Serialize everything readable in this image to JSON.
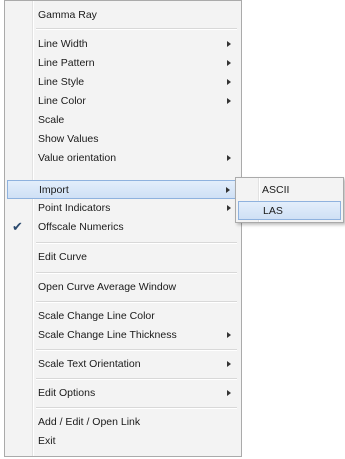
{
  "menu": {
    "items": [
      {
        "label": "Gamma Ray",
        "submenu": false
      },
      {
        "label": "Line Width",
        "submenu": true
      },
      {
        "label": "Line Pattern",
        "submenu": true
      },
      {
        "label": "Line Style",
        "submenu": true
      },
      {
        "label": "Line Color",
        "submenu": true
      },
      {
        "label": "Scale",
        "submenu": false
      },
      {
        "label": "Show Values",
        "submenu": false
      },
      {
        "label": "Value orientation",
        "submenu": true
      },
      {
        "label": "Import",
        "submenu": true,
        "highlighted": true
      },
      {
        "label": "Point Indicators",
        "submenu": true
      },
      {
        "label": "Offscale Numerics",
        "submenu": false,
        "checked": true
      },
      {
        "label": "Edit Curve",
        "submenu": false
      },
      {
        "label": "Open Curve Average Window",
        "submenu": false
      },
      {
        "label": "Scale Change Line Color",
        "submenu": false
      },
      {
        "label": "Scale Change Line Thickness",
        "submenu": true
      },
      {
        "label": "Scale Text Orientation",
        "submenu": true
      },
      {
        "label": "Edit Options",
        "submenu": true
      },
      {
        "label": "Add / Edit / Open Link",
        "submenu": false
      },
      {
        "label": "Exit",
        "submenu": false
      }
    ],
    "check_glyph": "✔"
  },
  "submenu": {
    "items": [
      {
        "label": "ASCII"
      },
      {
        "label": "LAS",
        "highlighted": true
      }
    ]
  },
  "colors": {
    "highlight_border": "#8fb2de",
    "highlight_fill": "#d8e6f7",
    "menu_bg": "#f3f3f3"
  }
}
